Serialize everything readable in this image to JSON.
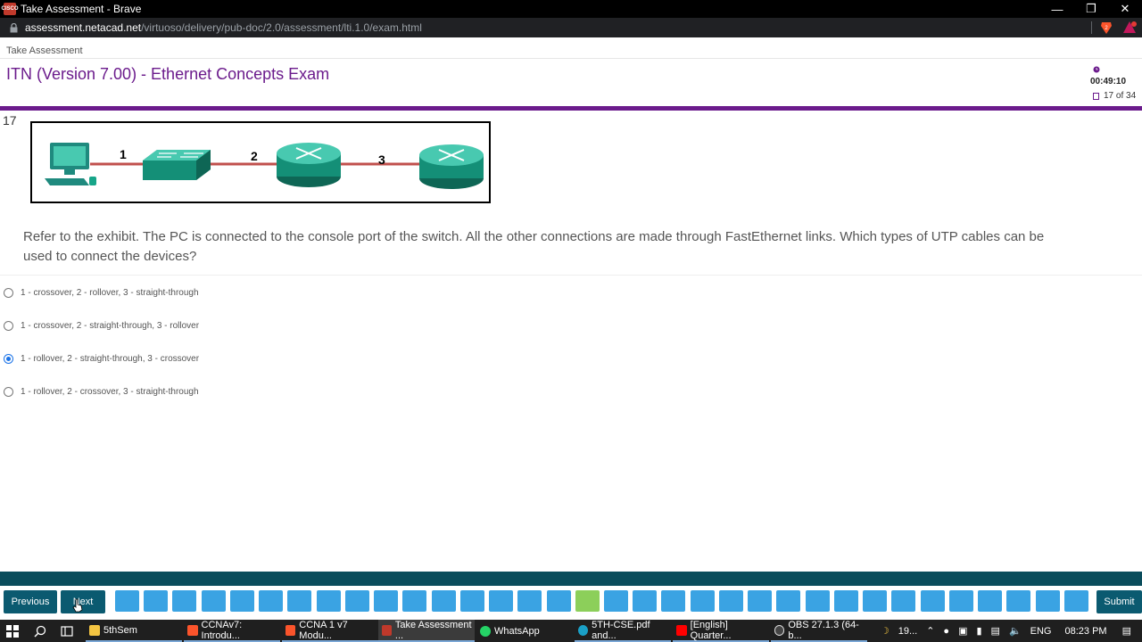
{
  "window": {
    "title": "Take Assessment - Brave",
    "app_icon_text": "CISCO"
  },
  "address": {
    "host": "assessment.netacad.net",
    "path": "/virtuoso/delivery/pub-doc/2.0/assessment/lti.1.0/exam.html"
  },
  "header": {
    "breadcrumb": "Take Assessment",
    "exam_title": "ITN (Version 7.00) - Ethernet Concepts Exam",
    "timer": "00:49:10",
    "progress": "17 of 34"
  },
  "question": {
    "number": "17",
    "exhibit_labels": [
      "1",
      "2",
      "3"
    ],
    "text": "Refer to the exhibit. The PC is connected to the console port of the switch. All the other connections are made through FastEthernet links. Which types of UTP cables can be used to connect the devices?",
    "options": [
      {
        "label": "1 - crossover, 2 - rollover, 3 - straight-through",
        "selected": false
      },
      {
        "label": "1 - crossover, 2 - straight-through, 3 - rollover",
        "selected": false
      },
      {
        "label": "1 - rollover, 2 - straight-through, 3 - crossover",
        "selected": true
      },
      {
        "label": "1 - rollover, 2 - crossover, 3 - straight-through",
        "selected": false
      }
    ]
  },
  "navigation": {
    "previous_label": "Previous",
    "next_label": "Next",
    "submit_label": "Submit",
    "question_count": 34,
    "current_question": 17
  },
  "taskbar": {
    "items": [
      {
        "label": "5thSem"
      },
      {
        "label": "CCNAv7: Introdu..."
      },
      {
        "label": "CCNA 1 v7 Modu..."
      },
      {
        "label": "Take Assessment ..."
      },
      {
        "label": "WhatsApp"
      },
      {
        "label": "5TH-CSE.pdf and..."
      },
      {
        "label": "[English] Quarter..."
      },
      {
        "label": "OBS 27.1.3 (64-b..."
      }
    ],
    "weather": "19...",
    "language": "ENG",
    "clock": "08:23 PM"
  },
  "colors": {
    "brand_purple": "#6b1b8c",
    "nav_teal": "#0b5a70",
    "question_button": "#3aa3e3",
    "current_question_button": "#8ccf5a",
    "cable": "#c0504d"
  }
}
